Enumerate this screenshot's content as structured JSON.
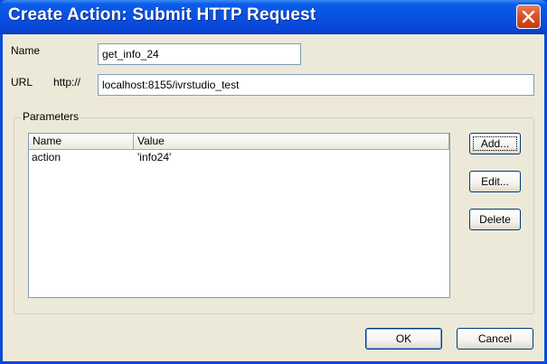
{
  "window": {
    "title": "Create Action: Submit HTTP Request"
  },
  "form": {
    "name_label": "Name",
    "name_value": "get_info_24",
    "url_label": "URL",
    "url_prefix": "http://",
    "url_value": "localhost:8155/ivrstudio_test"
  },
  "parameters": {
    "group_label": "Parameters",
    "columns": [
      "Name",
      "Value"
    ],
    "rows": [
      {
        "name": "action",
        "value": "'info24'"
      }
    ],
    "buttons": {
      "add": "Add...",
      "edit": "Edit...",
      "delete": "Delete"
    }
  },
  "footer": {
    "ok": "OK",
    "cancel": "Cancel"
  },
  "icons": {
    "close": "close-icon"
  },
  "colors": {
    "titlebar": "#0a4fe0",
    "close_button": "#d8532c",
    "dialog_background": "#ece9d8",
    "input_border": "#7f9db9"
  }
}
